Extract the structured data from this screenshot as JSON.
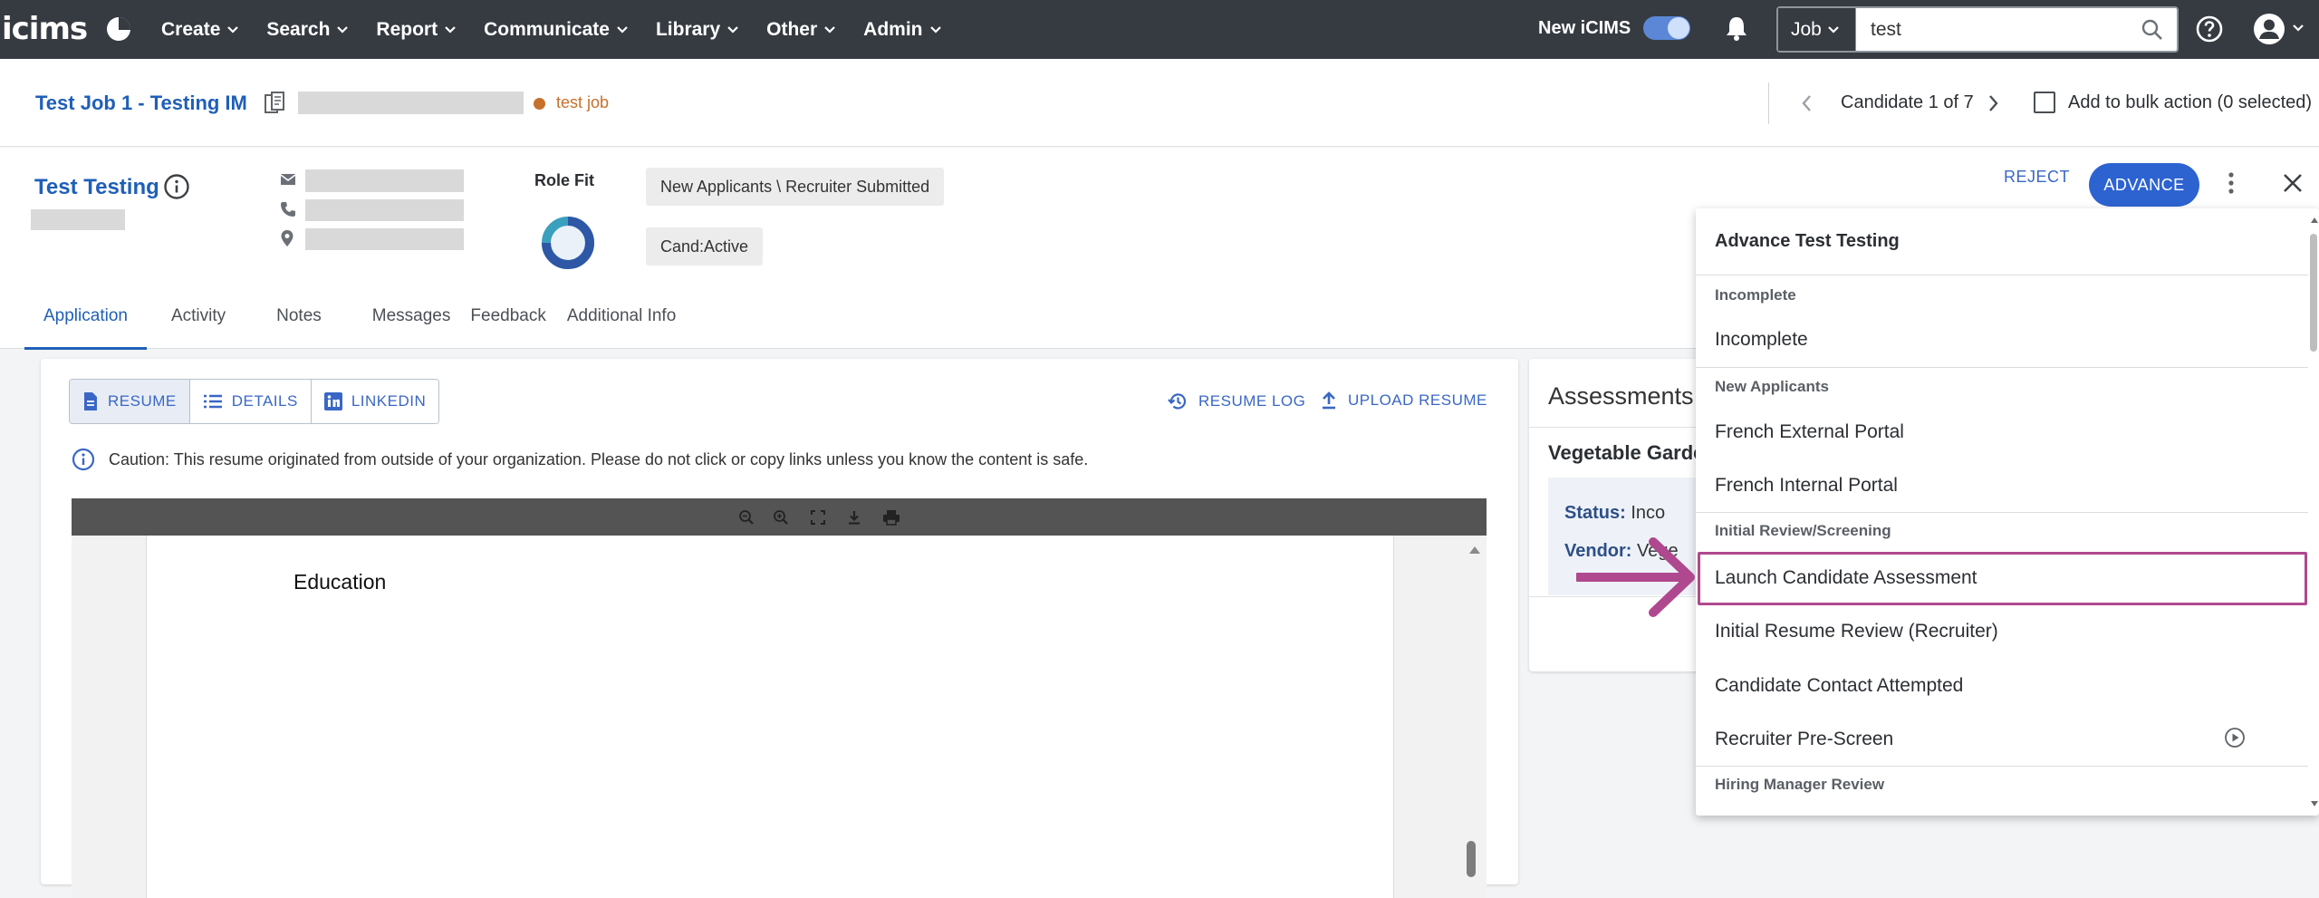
{
  "app": {
    "logo_text": "icims",
    "menu": [
      {
        "label": "Create"
      },
      {
        "label": "Search"
      },
      {
        "label": "Report"
      },
      {
        "label": "Communicate"
      },
      {
        "label": "Library"
      },
      {
        "label": "Other"
      },
      {
        "label": "Admin"
      }
    ],
    "new_icims_label": "New iCIMS",
    "new_icims_toggle": true,
    "search": {
      "scope": "Job",
      "value": "test"
    }
  },
  "job": {
    "title": "Test Job 1 - Testing IM",
    "tag": "test job",
    "tag_color": "#c6702c",
    "candidate_counter": "Candidate 1 of 7",
    "bulk_action_label": "Add to bulk action (0 selected)"
  },
  "candidate": {
    "name": "Test Testing",
    "role_fit_label": "Role Fit",
    "status_chip": "New Applicants \\ Recruiter Submitted",
    "cand_chip": "Cand:Active",
    "reject_label": "REJECT",
    "advance_label": "ADVANCE",
    "tabs": [
      {
        "label": "Application",
        "active": true
      },
      {
        "label": "Activity"
      },
      {
        "label": "Notes"
      },
      {
        "label": "Messages"
      },
      {
        "label": "Feedback"
      },
      {
        "label": "Additional Info"
      }
    ]
  },
  "resume": {
    "views": [
      {
        "label": "RESUME",
        "icon": "document-icon",
        "active": true
      },
      {
        "label": "DETAILS",
        "icon": "list-icon"
      },
      {
        "label": "LINKEDIN",
        "icon": "linkedin-icon"
      }
    ],
    "resume_log_label": "RESUME LOG",
    "upload_resume_label": "UPLOAD RESUME",
    "caution_text": "Caution: This resume originated from outside of your organization. Please do not click or copy links unless you know the content is safe.",
    "doc_heading": "Education"
  },
  "assessments": {
    "title": "Assessments",
    "name": "Vegetable Garde",
    "status_label": "Status:",
    "status_value": "Inco",
    "vendor_label": "Vendor:",
    "vendor_value": "Vege"
  },
  "advance_menu": {
    "title": "Advance Test Testing",
    "groups": [
      {
        "name": "Incomplete",
        "items": [
          "Incomplete"
        ]
      },
      {
        "name": "New Applicants",
        "items": [
          "French External Portal",
          "French Internal Portal"
        ]
      },
      {
        "name": "Initial Review/Screening",
        "items": [
          "Launch Candidate Assessment",
          "Initial Resume Review (Recruiter)",
          "Candidate Contact Attempted",
          "Recruiter Pre-Screen"
        ]
      },
      {
        "name": "Hiring Manager Review",
        "items": []
      }
    ],
    "highlighted_item": "Launch Candidate Assessment",
    "highlight_color": "#b0488f"
  },
  "colors": {
    "nav_bg": "#363b42",
    "link_blue": "#1f5fb8",
    "primary_button": "#2d63d1"
  }
}
